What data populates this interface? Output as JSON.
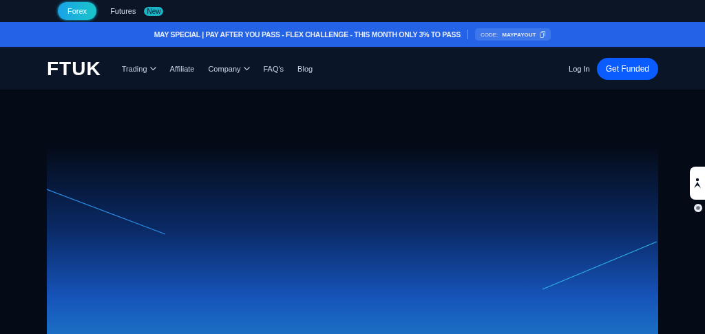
{
  "market_tabs": [
    {
      "label": "Forex",
      "selected": true
    },
    {
      "label": "Futures",
      "selected": false,
      "badge": "New"
    }
  ],
  "promo": {
    "text": "MAY SPECIAL | PAY AFTER YOU PASS - FLEX CHALLENGE - THIS MONTH ONLY 3% TO PASS",
    "code_label": "CODE:",
    "code": "MAYPAYOUT"
  },
  "nav": {
    "logo": "FTUK",
    "items": [
      {
        "label": "Trading",
        "dropdown": true
      },
      {
        "label": "Affiliate",
        "dropdown": false
      },
      {
        "label": "Company",
        "dropdown": true
      },
      {
        "label": "FAQ's",
        "dropdown": false
      },
      {
        "label": "Blog",
        "dropdown": false
      }
    ],
    "login": "Log In",
    "cta": "Get Funded"
  }
}
